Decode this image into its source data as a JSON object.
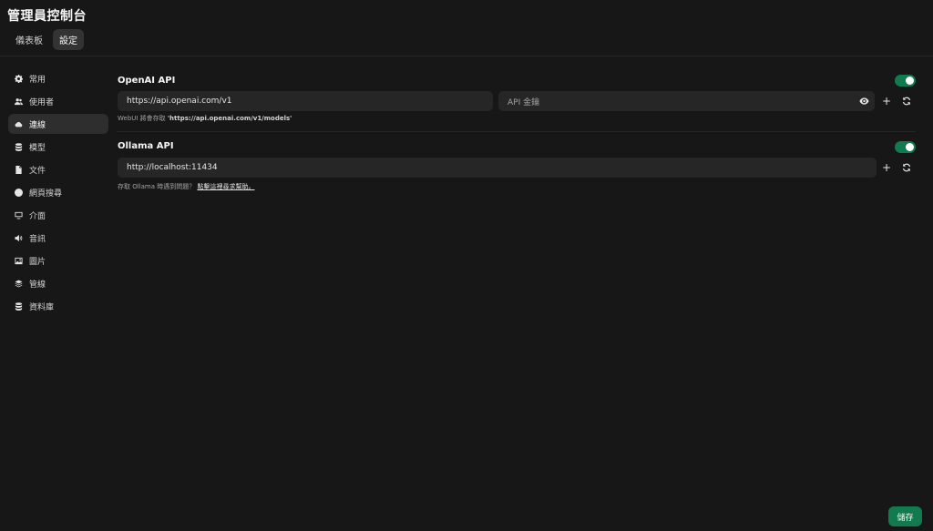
{
  "app": {
    "title": "管理員控制台"
  },
  "top_tabs": [
    {
      "label": "儀表板",
      "active": false
    },
    {
      "label": "設定",
      "active": true
    }
  ],
  "sidebar": {
    "items": [
      {
        "label": "常用",
        "icon": "gear-icon"
      },
      {
        "label": "使用者",
        "icon": "users-icon"
      },
      {
        "label": "連線",
        "icon": "cloud-icon",
        "active": true
      },
      {
        "label": "模型",
        "icon": "database-icon"
      },
      {
        "label": "文件",
        "icon": "document-icon"
      },
      {
        "label": "網頁搜尋",
        "icon": "globe-icon"
      },
      {
        "label": "介面",
        "icon": "monitor-icon"
      },
      {
        "label": "音訊",
        "icon": "speaker-icon"
      },
      {
        "label": "圖片",
        "icon": "image-icon"
      },
      {
        "label": "管線",
        "icon": "layers-icon"
      },
      {
        "label": "資料庫",
        "icon": "database-icon"
      }
    ]
  },
  "openai": {
    "title": "OpenAI API",
    "enabled": true,
    "url_value": "https://api.openai.com/v1",
    "key_placeholder": "API 金鑰",
    "hint_prefix": "WebUI 將會存取 ",
    "hint_url": "'https://api.openai.com/v1/models'"
  },
  "ollama": {
    "title": "Ollama API",
    "enabled": true,
    "url_value": "http://localhost:11434",
    "hint_prefix": "存取 Ollama 時遇到問題？",
    "hint_link": "點擊這裡尋求幫助。"
  },
  "actions": {
    "save_label": "儲存",
    "add_symbol": "+"
  },
  "colors": {
    "background": "#171717",
    "accent": "#117a4e",
    "input": "#262626"
  }
}
